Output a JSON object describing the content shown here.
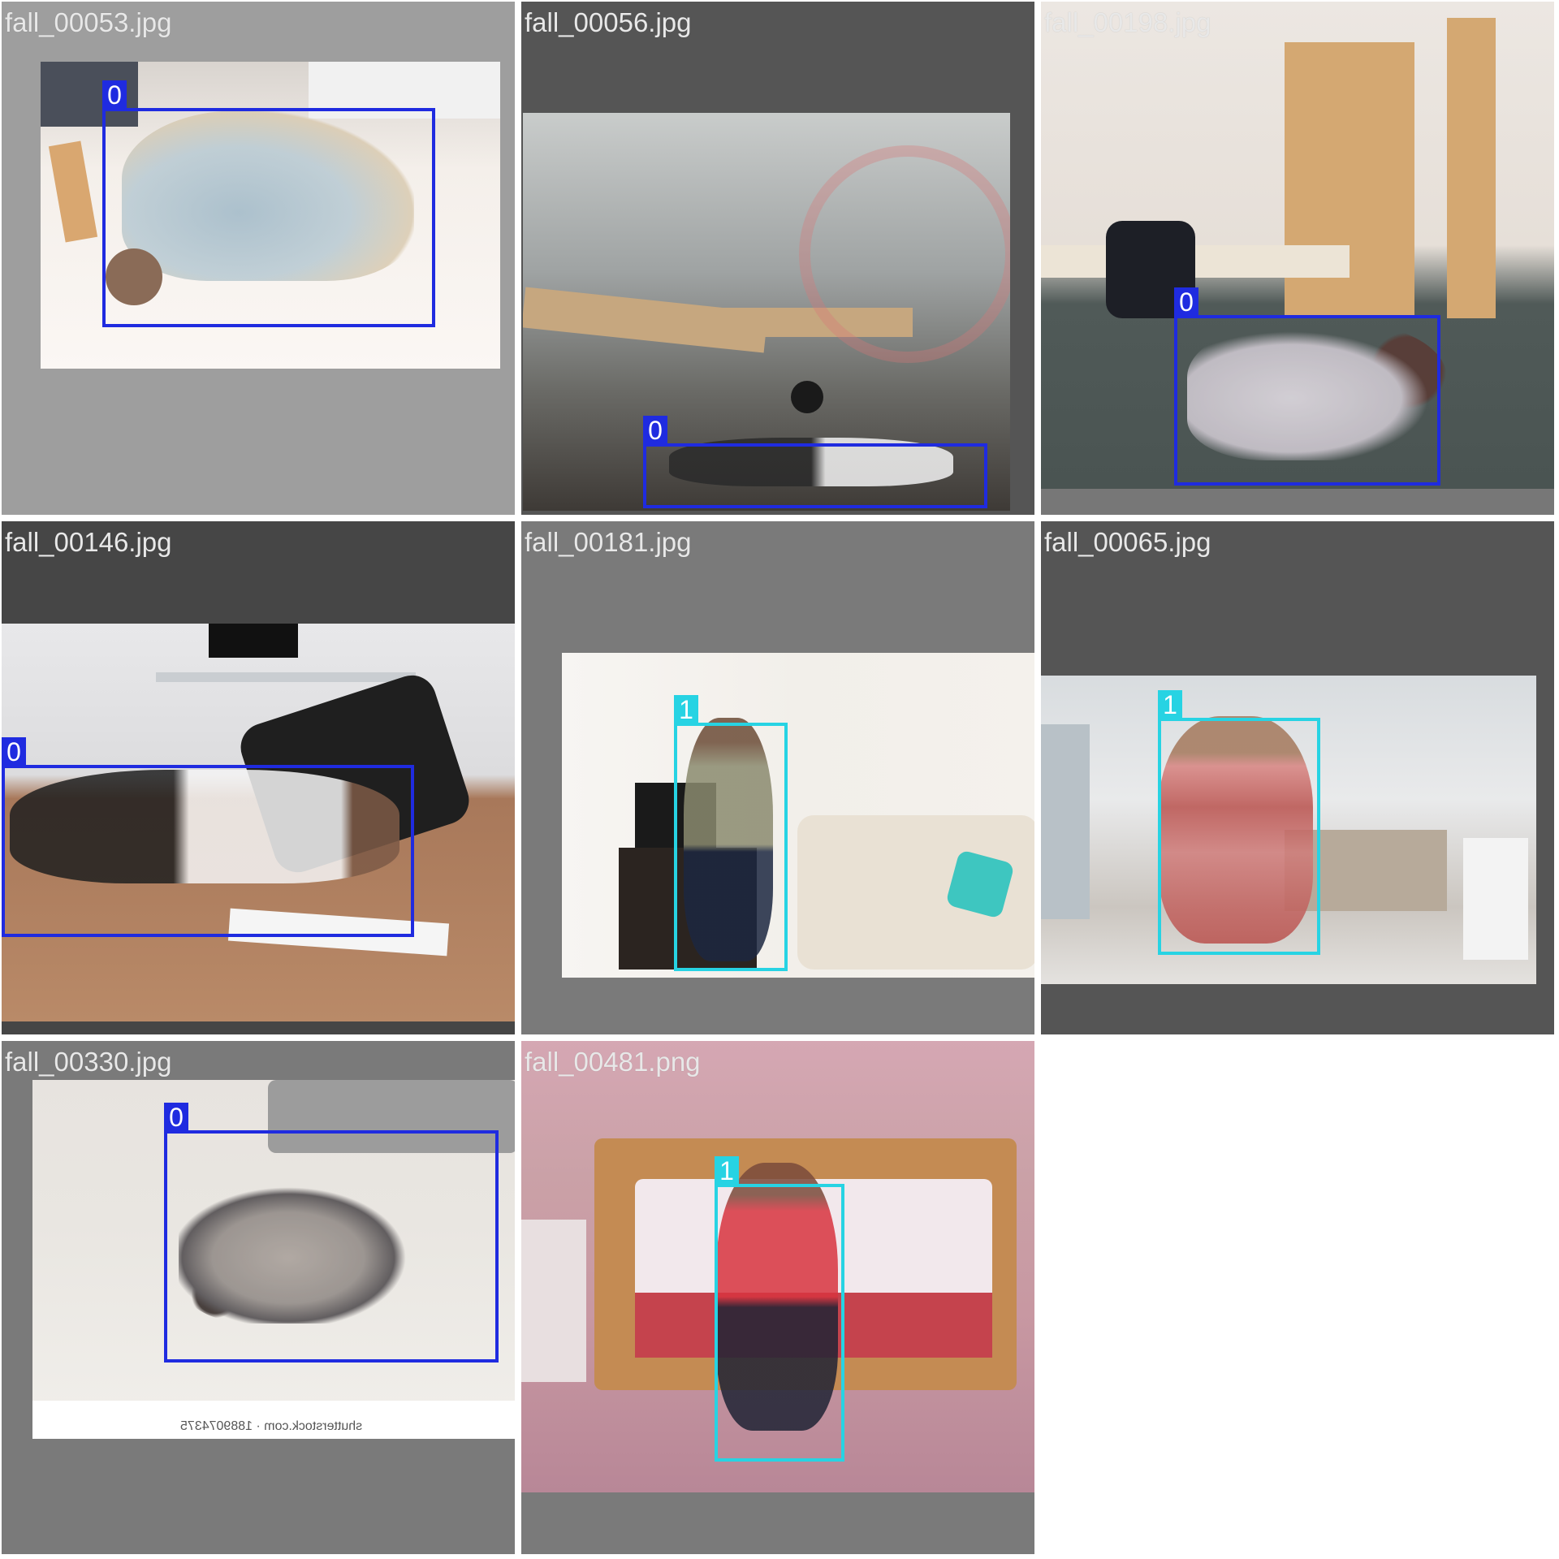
{
  "mosaic": {
    "tiles": [
      {
        "filename": "fall_00053.jpg",
        "boxes": [
          {
            "class_label": "0",
            "class_id": 0
          }
        ]
      },
      {
        "filename": "fall_00056.jpg",
        "boxes": [
          {
            "class_label": "0",
            "class_id": 0
          }
        ]
      },
      {
        "filename": "fall_00198.jpg",
        "boxes": [
          {
            "class_label": "0",
            "class_id": 0
          }
        ]
      },
      {
        "filename": "fall_00146.jpg",
        "boxes": [
          {
            "class_label": "0",
            "class_id": 0
          }
        ]
      },
      {
        "filename": "fall_00181.jpg",
        "boxes": [
          {
            "class_label": "1",
            "class_id": 1
          }
        ]
      },
      {
        "filename": "fall_00065.jpg",
        "boxes": [
          {
            "class_label": "1",
            "class_id": 1
          }
        ]
      },
      {
        "filename": "fall_00330.jpg",
        "boxes": [
          {
            "class_label": "0",
            "class_id": 0
          }
        ]
      },
      {
        "filename": "fall_00481.png",
        "boxes": [
          {
            "class_label": "1",
            "class_id": 1
          }
        ]
      }
    ],
    "watermarks": {
      "fall_00330": "shutterstock.com · 1889074375"
    },
    "colors": {
      "class_0": "#1f2be0",
      "class_1": "#27d3e3",
      "label_text": "#ffffff"
    }
  }
}
